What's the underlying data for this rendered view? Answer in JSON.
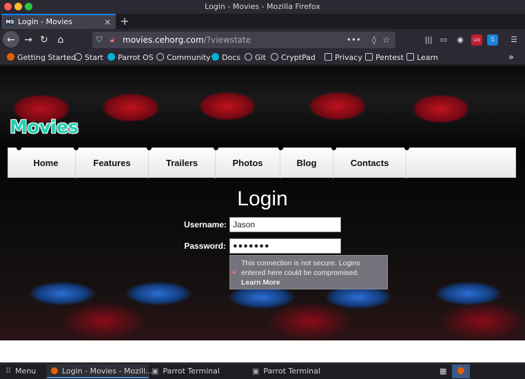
{
  "window": {
    "title": "Login - Movies - Mozilla Firefox"
  },
  "tab": {
    "title": "Login - Movies",
    "favicon_text": "MS",
    "close": "×",
    "new_tab": "+"
  },
  "nav": {
    "back": "←",
    "forward": "→",
    "reload": "↻",
    "home": "⌂"
  },
  "url": {
    "host": "movies.cehorg.com",
    "path": "/?viewstate",
    "more": "•••"
  },
  "bookmarks": [
    {
      "label": "Getting Started",
      "icon": "firefox-icon",
      "color": "#e66000"
    },
    {
      "label": "Start",
      "icon": "globe-icon",
      "color": "#cfcfd8"
    },
    {
      "label": "Parrot OS",
      "icon": "parrot-icon",
      "color": "#05b3d8"
    },
    {
      "label": "Community",
      "icon": "globe-icon",
      "color": "#cfcfd8"
    },
    {
      "label": "Docs",
      "icon": "parrot-icon",
      "color": "#05b3d8"
    },
    {
      "label": "Git",
      "icon": "globe-icon",
      "color": "#cfcfd8"
    },
    {
      "label": "CryptPad",
      "icon": "globe-icon",
      "color": "#cfcfd8"
    },
    {
      "label": "Privacy",
      "icon": "folder-icon",
      "color": "#cfcfd8"
    },
    {
      "label": "Pentest",
      "icon": "folder-icon",
      "color": "#cfcfd8"
    },
    {
      "label": "Learn",
      "icon": "folder-icon",
      "color": "#cfcfd8"
    }
  ],
  "site": {
    "logo": "Movies",
    "menu": [
      "Home",
      "Features",
      "Trailers",
      "Photos",
      "Blog",
      "Contacts"
    ],
    "login_title": "Login",
    "username_label": "Username:",
    "username_value": "Jason",
    "password_label": "Password:",
    "password_value": "●●●●●●●",
    "warning_text": "This connection is not secure. Logins entered here could be compromised.",
    "warning_link": "Learn More"
  },
  "taskbar": {
    "menu": "Menu",
    "items": [
      "Login - Movies - Mozill...",
      "Parrot Terminal",
      "Parrot Terminal"
    ]
  },
  "colors": {
    "accent": "#0a84ff",
    "logo": "#1fd0b0",
    "seats": "#c0121f"
  }
}
